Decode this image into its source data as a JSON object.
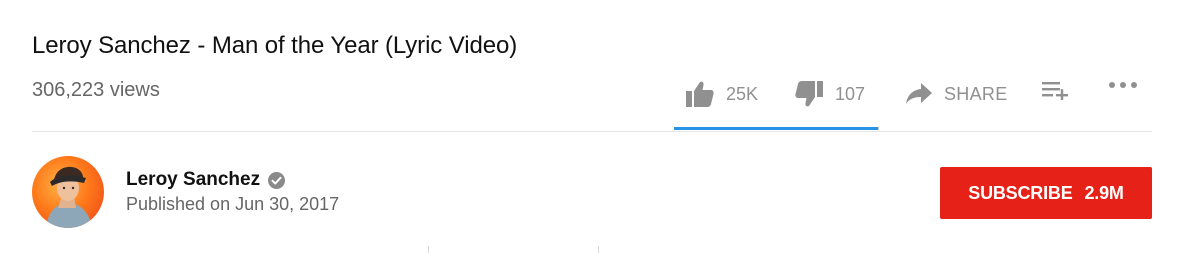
{
  "video": {
    "title": "Leroy Sanchez - Man of the Year (Lyric Video)",
    "views": "306,223 views"
  },
  "actions": {
    "like_count": "25K",
    "dislike_count": "107",
    "share_label": "SHARE",
    "like_ratio": 0.9957,
    "icons": {
      "like": "thumbs-up-icon",
      "dislike": "thumbs-down-icon",
      "share": "share-arrow-icon",
      "add_to": "add-to-playlist-icon",
      "more": "more-dots-icon"
    }
  },
  "channel": {
    "name": "Leroy Sanchez",
    "published": "Published on Jun 30, 2017",
    "verified_icon": "verified-check-icon",
    "avatar_icon": "channel-avatar"
  },
  "subscribe": {
    "label": "SUBSCRIBE",
    "count": "2.9M"
  },
  "colors": {
    "subscribe_bg": "#e62117",
    "sentiment_like": "#2793e6",
    "sentiment_base": "#cccccc",
    "icon_gray": "#909090"
  }
}
